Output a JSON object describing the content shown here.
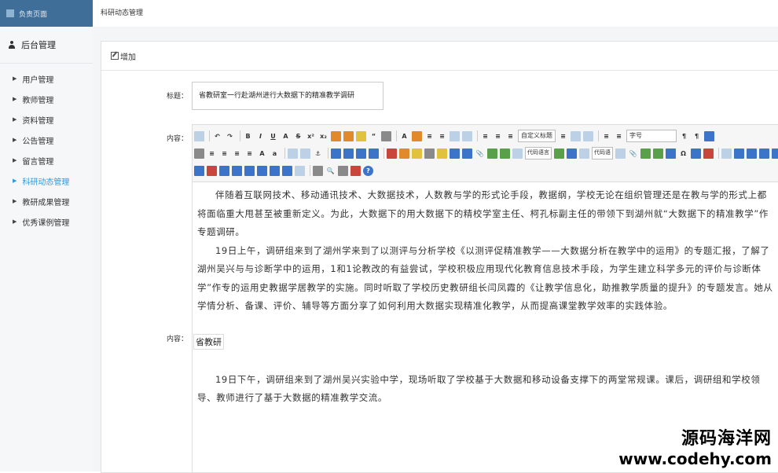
{
  "app": {
    "logo_text": "负责页面"
  },
  "sidebar": {
    "heading": "后台管理",
    "items": [
      {
        "label": "用户管理",
        "active": false
      },
      {
        "label": "教师管理",
        "active": false
      },
      {
        "label": "资料管理",
        "active": false
      },
      {
        "label": "公告管理",
        "active": false
      },
      {
        "label": "留言管理",
        "active": false
      },
      {
        "label": "科研动态管理",
        "active": true
      },
      {
        "label": "教研成果管理",
        "active": false
      },
      {
        "label": "优秀课例管理",
        "active": false
      }
    ],
    "active_color": "#2b9be0"
  },
  "header": {
    "breadcrumb": "科研动态管理"
  },
  "panel": {
    "title": "增加"
  },
  "form": {
    "title_label": "标题：",
    "title_value": "省教研室一行赴湖州进行大数据下的精准教学调研",
    "content_label": "内容：",
    "content_label_2": "内容："
  },
  "editor": {
    "toolbar": {
      "paragraph_select": "自定义标题",
      "font_select": "字号",
      "code_button_1": "代码语言",
      "code_button_2": "代码语"
    },
    "paragraphs": [
      "伴随着互联网技术、移动通讯技术、大数据技术，人数教与学的形式论手段，教据纲，学校无论在组织管理还是在教与学的形式上都将面临重大甩甚至被重新定义。为此，大数据下的用大数据下的精校学室主任、柯孔标副主任的带领下到湖州就“大数据下的精准教学”作专题调研。",
      "19日上午，调研组来到了湖州学来到了以测评与分析学校《以测评促精准教学——大数据分析在教学中的运用》的专题汇报，了解了湖州吴兴与与诊断学中的运用，1和1论教改的有益尝试，学校积极应用现代化教育信息技术手段，为学生建立科学多元的评价与诊断体学”作专的运用史教据学居教学的实施。同时听取了学校历史教研组长闫凤霞的《让教学信息化，助推教学质量的提升》的专题发言。她从学情分析、备课、评价、辅导等方面分享了如何利用大数据实现精准化教学，从而提高课堂教学效率的实践体验。",
      "19日下午，调研组来到了湖州吴兴实验中学，现场听取了学校基于大数据和移动设备支撑下的两堂常规课。课后，调研组和学校领导、教师进行了基于大数据的精准教学交流。"
    ],
    "tooltip_fragment": "省教研"
  },
  "watermark": {
    "line1": "源码海洋网",
    "line2": "www.codehy.com"
  }
}
